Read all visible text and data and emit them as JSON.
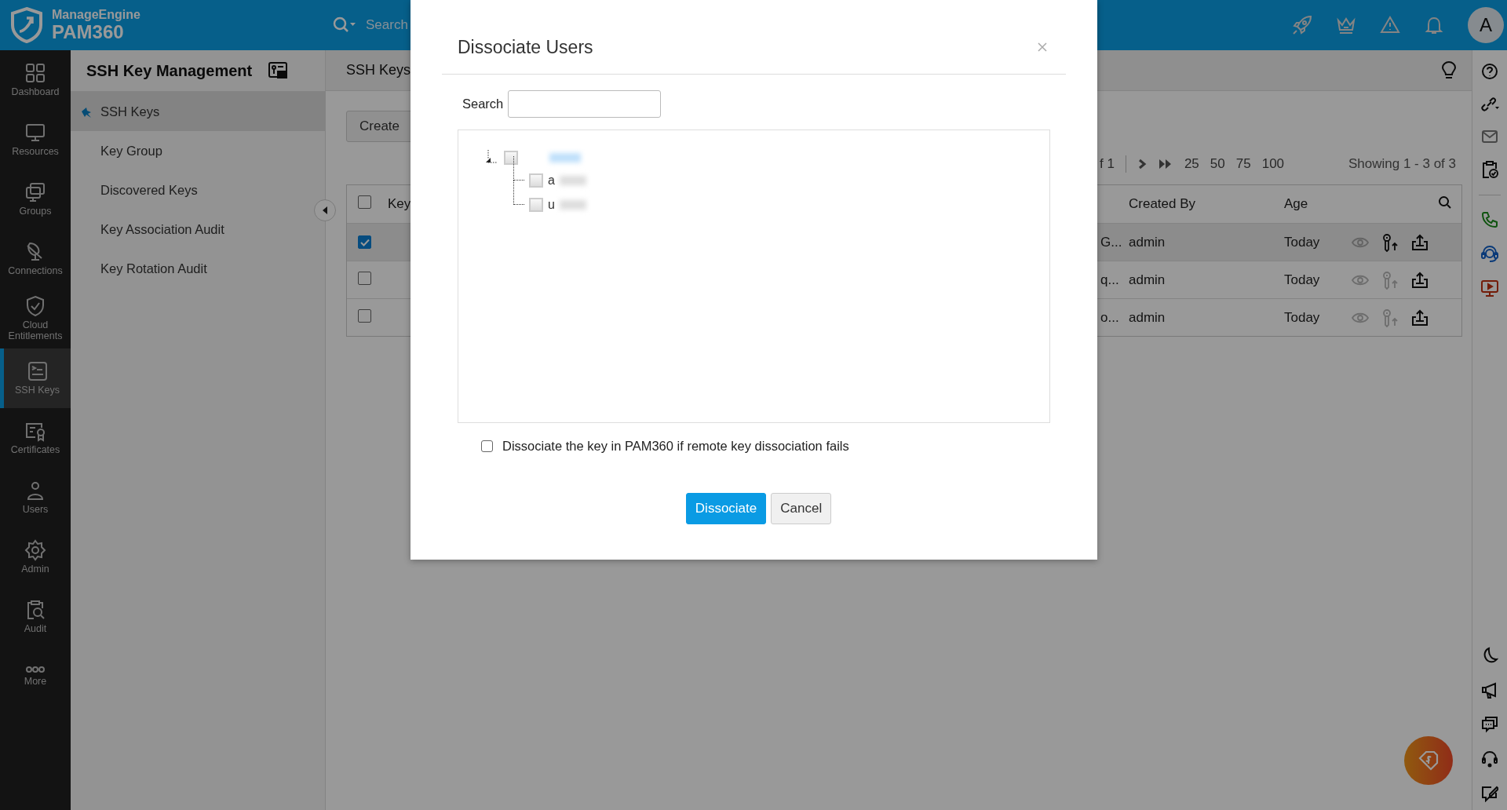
{
  "topbar": {
    "brand": "ManageEngine",
    "product": "PAM360",
    "search_placeholder": "Search",
    "avatar": "A"
  },
  "nav": [
    {
      "label": "Dashboard",
      "selected": false
    },
    {
      "label": "Resources",
      "selected": false
    },
    {
      "label": "Groups",
      "selected": false
    },
    {
      "label": "Connections",
      "selected": false
    },
    {
      "label": "Cloud Entitlements",
      "selected": false
    },
    {
      "label": "SSH Keys",
      "selected": true
    },
    {
      "label": "Certificates",
      "selected": false
    },
    {
      "label": "Users",
      "selected": false
    },
    {
      "label": "Admin",
      "selected": false
    },
    {
      "label": "Audit",
      "selected": false
    },
    {
      "label": "More",
      "selected": false
    }
  ],
  "submenu": {
    "title": "SSH Key Management",
    "items": [
      {
        "label": "SSH Keys",
        "selected": true,
        "pinned": true
      },
      {
        "label": "Key Group",
        "selected": false,
        "pinned": false
      },
      {
        "label": "Discovered Keys",
        "selected": false,
        "pinned": false
      },
      {
        "label": "Key Association Audit",
        "selected": false,
        "pinned": false
      },
      {
        "label": "Key Rotation Audit",
        "selected": false,
        "pinned": false
      }
    ]
  },
  "main": {
    "title": "SSH Keys",
    "create_button": "Create",
    "pagination": {
      "page_of": "f 1",
      "sizes": [
        "25",
        "50",
        "75",
        "100"
      ],
      "showing": "Showing 1 - 3 of 3"
    },
    "table": {
      "all_checked": false,
      "columns": [
        "Key",
        "Created By",
        "Age"
      ],
      "rows": [
        {
          "checked": true,
          "key_tail": "G...",
          "created_by": "admin",
          "age": "Today",
          "view_disabled": true,
          "rotate_disabled": false
        },
        {
          "checked": false,
          "key_tail": "q...",
          "created_by": "admin",
          "age": "Today",
          "view_disabled": true,
          "rotate_disabled": true
        },
        {
          "checked": false,
          "key_tail": "o...",
          "created_by": "admin",
          "age": "Today",
          "view_disabled": true,
          "rotate_disabled": true
        }
      ]
    }
  },
  "dialog": {
    "title": "Dissociate Users",
    "search_label": "Search",
    "tree": {
      "expanded": true,
      "checked": false,
      "children": [
        {
          "label": "a",
          "checked": false
        },
        {
          "label": "u",
          "checked": false
        }
      ]
    },
    "option": {
      "label": "Dissociate the key in PAM360 if remote key dissociation fails",
      "checked": false
    },
    "buttons": [
      {
        "label": "Dissociate",
        "kind": "primary"
      },
      {
        "label": "Cancel",
        "kind": "secondary"
      }
    ]
  }
}
